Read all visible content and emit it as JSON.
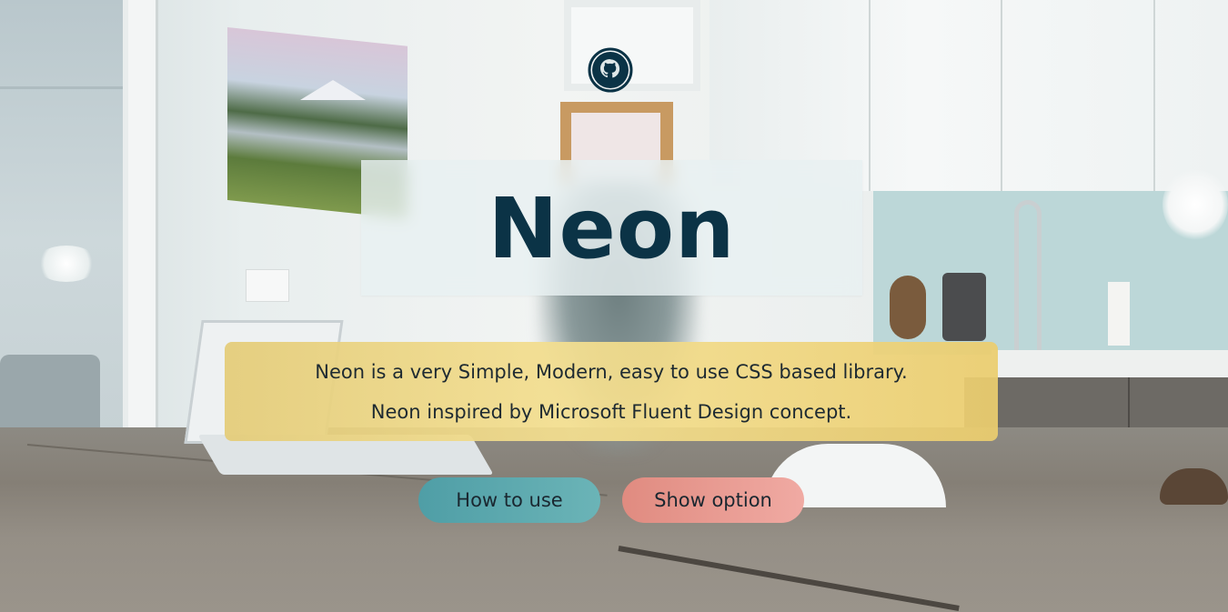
{
  "app": {
    "title": "Neon",
    "description_lines": [
      "Neon is a very Simple, Modern, easy to use CSS based library.",
      "Neon inspired by Microsoft Fluent Design concept."
    ]
  },
  "header": {
    "github_icon": "github-icon"
  },
  "actions": {
    "how_to_use_label": "How to use",
    "show_option_label": "Show option"
  },
  "colors": {
    "title_text": "#0b3346",
    "github_icon": "#0b3346",
    "description_panel": "#eed58d",
    "how_to_use_button": "#5ea9ae",
    "show_option_button": "#e89a92"
  }
}
